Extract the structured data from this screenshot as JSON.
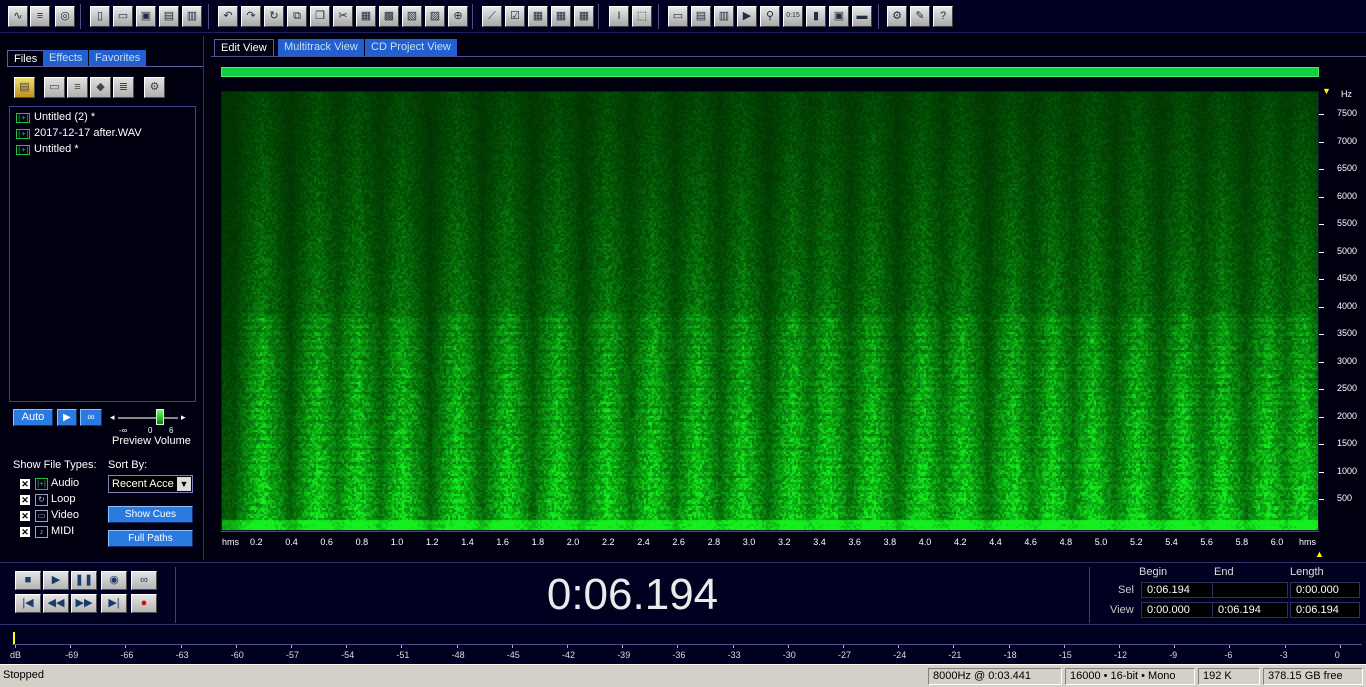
{
  "toolbar": {
    "icons": [
      "waveform-view-icon",
      "multitrack-view-icon",
      "cd-view-icon",
      "new-icon",
      "open-icon",
      "close-icon",
      "save-icon",
      "save-all-icon",
      "undo-icon",
      "redo-icon",
      "repeat-icon",
      "copy-new-icon",
      "copy-icon",
      "cut-icon",
      "paste-icon",
      "paste-new-icon",
      "mix-paste-icon",
      "trim-icon",
      "zero-cross-icon",
      "envelope-icon",
      "snap-icon",
      "spectral-icon",
      "grid-icon",
      "ruler-icon",
      "select-cursor-icon",
      "marquee-icon",
      "window-icon",
      "clip-icon",
      "cue-icon",
      "play-list-icon",
      "zoom-icon",
      "time-icon",
      "level-icon",
      "info-icon",
      "bar-icon",
      "settings-icon",
      "script-icon",
      "help-icon"
    ]
  },
  "left": {
    "tabs": [
      "Files",
      "Effects",
      "Favorites"
    ],
    "files": [
      "Untitled (2) *",
      "2017-12-17 after.WAV",
      "Untitled *"
    ],
    "auto_label": "Auto",
    "volume_label": "Preview Volume",
    "volume_ticks": [
      "-∞",
      "0",
      "6"
    ],
    "volume_level": 0.7,
    "show_types_label": "Show File Types:",
    "file_types": [
      {
        "label": "Audio",
        "checked": true
      },
      {
        "label": "Loop",
        "checked": true
      },
      {
        "label": "Video",
        "checked": true
      },
      {
        "label": "MIDI",
        "checked": true
      }
    ],
    "sort_label": "Sort By:",
    "sort_value": "Recent Acce",
    "show_cues": "Show Cues",
    "full_paths": "Full Paths"
  },
  "views": {
    "tabs": [
      "Edit View",
      "Multitrack View",
      "CD Project View"
    ],
    "active": 0
  },
  "spectrogram": {
    "hz_unit": "Hz",
    "hz_ticks": [
      "7500",
      "7000",
      "6500",
      "6000",
      "5500",
      "5000",
      "4500",
      "4000",
      "3500",
      "3000",
      "2500",
      "2000",
      "1500",
      "1000",
      "500"
    ],
    "time_unit": "hms",
    "time_ticks": [
      "0.2",
      "0.4",
      "0.6",
      "0.8",
      "1.0",
      "1.2",
      "1.4",
      "1.6",
      "1.8",
      "2.0",
      "2.2",
      "2.4",
      "2.6",
      "2.8",
      "3.0",
      "3.2",
      "3.4",
      "3.6",
      "3.8",
      "4.0",
      "4.2",
      "4.4",
      "4.6",
      "4.8",
      "5.0",
      "5.2",
      "5.4",
      "5.6",
      "5.8",
      "6.0"
    ],
    "color": "#3cd23c"
  },
  "transport": {
    "time": "0:06.194",
    "headers": {
      "begin": "Begin",
      "end": "End",
      "length": "Length"
    },
    "sel_label": "Sel",
    "view_label": "View",
    "sel": {
      "begin": "0:06.194",
      "end": "",
      "length": "0:00.000"
    },
    "view": {
      "begin": "0:00.000",
      "end": "0:06.194",
      "length": "0:06.194"
    }
  },
  "meter": {
    "ticks": [
      "dB",
      "-69",
      "-66",
      "-63",
      "-60",
      "-57",
      "-54",
      "-51",
      "-48",
      "-45",
      "-42",
      "-39",
      "-36",
      "-33",
      "-30",
      "-27",
      "-24",
      "-21",
      "-18",
      "-15",
      "-12",
      "-9",
      "-6",
      "-3",
      "0"
    ]
  },
  "status": {
    "state": "Stopped",
    "rate_pos": "8000Hz @   0:03.441",
    "format": "16000 • 16-bit • Mono",
    "size": "192 K",
    "free": "378.15 GB free"
  }
}
